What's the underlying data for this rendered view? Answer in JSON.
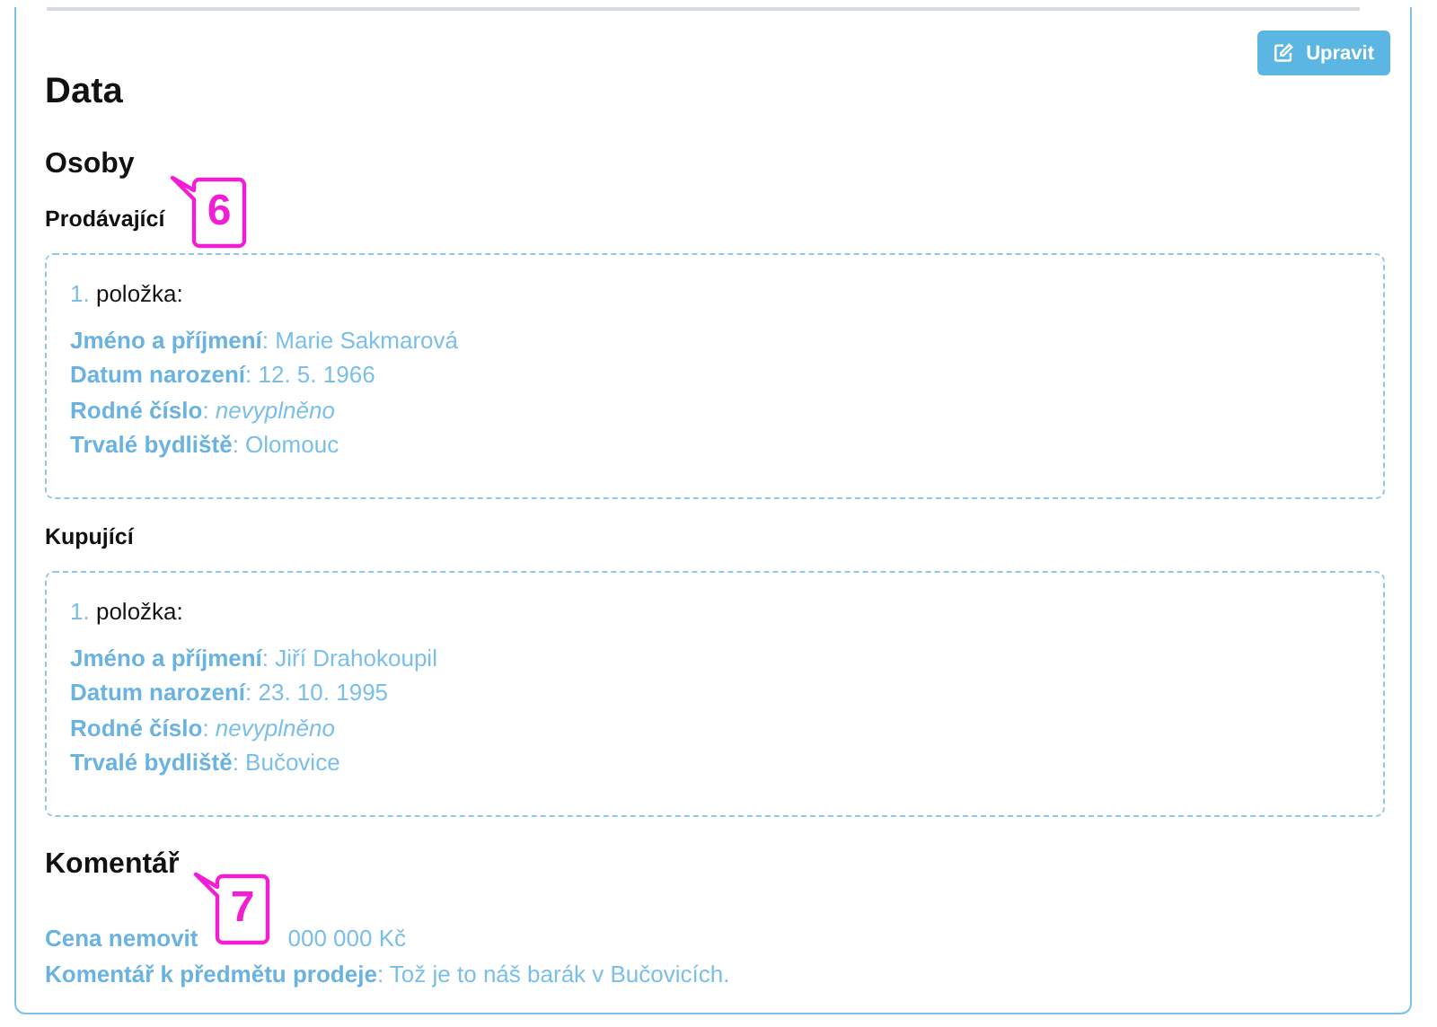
{
  "edit_button": {
    "label": "Upravit"
  },
  "title": "Data",
  "persons_heading": "Osoby",
  "groups": [
    {
      "heading": "Prodávající",
      "items": [
        {
          "number": "1.",
          "label": "položka:",
          "fields": [
            "**Jméno a příjmení**: Marie Sakmarová",
            "**Datum narození**: 12. 5. 1966",
            "**Rodné číslo**: *nevyplněno*",
            "**Trvalé bydliště**: Olomouc"
          ]
        }
      ]
    },
    {
      "heading": "Kupující",
      "items": [
        {
          "number": "1.",
          "label": "položka:",
          "fields": [
            "**Jméno a příjmení**: Jiří Drahokoupil",
            "**Datum narození**: 23. 10. 1995",
            "**Rodné číslo**: *nevyplněno*",
            "**Trvalé bydliště**: Bučovice"
          ]
        }
      ]
    }
  ],
  "comment_heading": "Komentář",
  "price_label": "Cena nemovit",
  "price_value": "000 000 Kč",
  "comment_line": "**Komentář k předmětu prodeje**: Tož je to náš barák v Bučovicích.",
  "callouts": [
    {
      "number": "6"
    },
    {
      "number": "7"
    }
  ]
}
